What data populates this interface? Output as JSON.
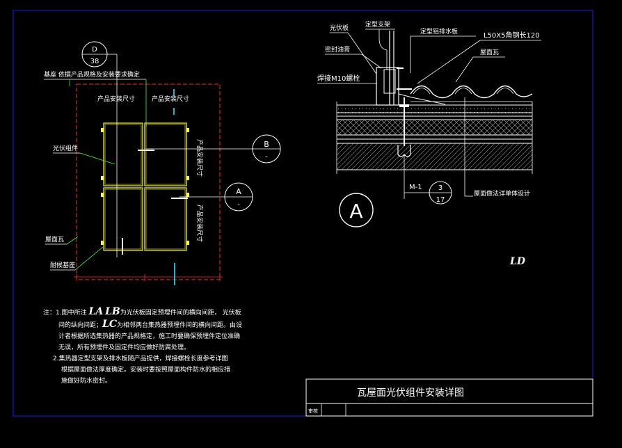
{
  "colors": {
    "background": "#000000",
    "frame": "#1a1aff",
    "yellow": "#ffff33",
    "green": "#33ff33",
    "red": "#ff2a2a",
    "cyan": "#33e0ff",
    "white": "#ffffff"
  },
  "plan": {
    "ref_top_num": "D",
    "ref_top_den": "38",
    "label_base": "基座 依据产品规格及安装要求确定",
    "label_size1": "产品安装尺寸",
    "label_size2": "产品安装尺寸",
    "label_pv": "光伏组件",
    "label_tile": "屋面瓦",
    "label_base2": "耐候基座",
    "vert_size1": "产品安装尺寸",
    "vert_size2": "产品安装尺寸",
    "ref_b_num": "B",
    "ref_b_den": "-",
    "ref_a_num": "A",
    "ref_a_den": "-"
  },
  "section": {
    "label_pv": "光伏板",
    "label_bracket": "定型支架",
    "label_flashing": "定型铝排水板",
    "label_angle": "L50X5角钢长120",
    "label_sealant": "密封油膏",
    "label_tile": "屋面瓦",
    "label_bolt": "焊接M10螺栓",
    "label_m1": "M-1",
    "ref_num": "3",
    "ref_den": "17",
    "label_roof": "屋面做法详单体设计",
    "marker": "A",
    "ld": "LD"
  },
  "notes": {
    "prefix": "注：",
    "line1a": "1.图中所注",
    "line1_la": "LA",
    "line1_lb": "LB",
    "line1b": "为光伏板固定预埋件间的横向间距，  光伏板",
    "line2a": "间的纵向间距；",
    "line2_lc": "LC",
    "line2b": "为相邻两台集热器预埋件间的横向间距。由设",
    "line3": "计者根据所选集热器的产品规格定，施工时要确保预埋件定位准确",
    "line4": "无误，所有预埋件及固定件均应做好防腐处理。",
    "line5": "2.集热器定型支架及排水板随产品提供，焊接螺栓长度参考详图",
    "line6": "根据屋面做法厚度确定。安装时要按照屋面构件防水的相应措",
    "line7": "施做好防水密封。"
  },
  "title_block": {
    "title": "瓦屋面光伏组件安装详图",
    "label": "审核"
  }
}
